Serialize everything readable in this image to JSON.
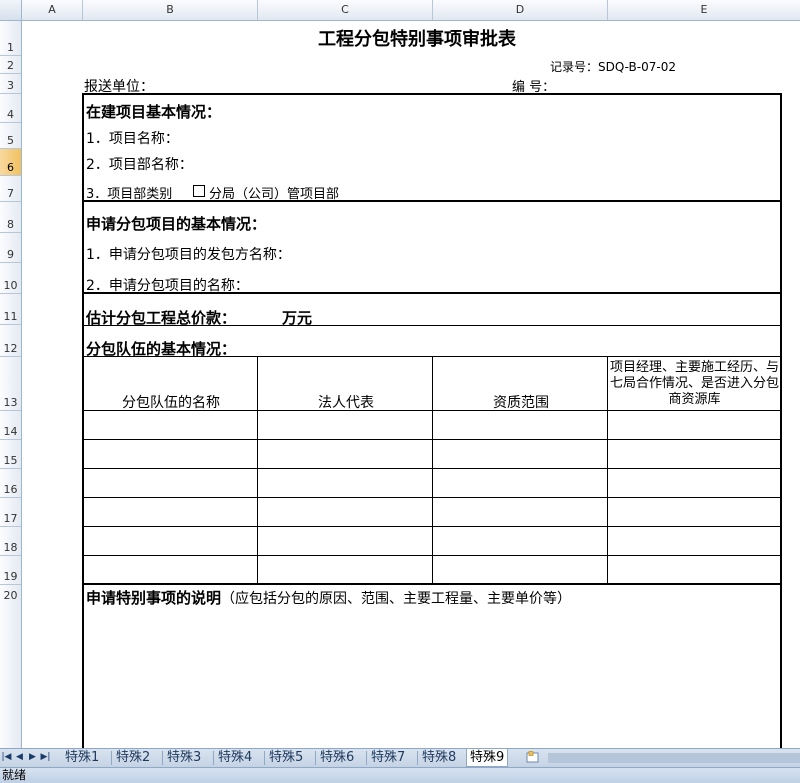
{
  "columns": [
    "A",
    "B",
    "C",
    "D",
    "E"
  ],
  "rows": [
    "1",
    "2",
    "3",
    "4",
    "5",
    "6",
    "7",
    "8",
    "9",
    "10",
    "11",
    "12",
    "13",
    "14",
    "15",
    "16",
    "17",
    "18",
    "19",
    "20"
  ],
  "selected_row": "6",
  "form": {
    "title": "工程分包特别事项审批表",
    "record_no": "记录号：SDQ-B-07-02",
    "submit_unit": "报送单位：",
    "number_label": "编    号：",
    "section1_title": "在建项目基本情况：",
    "project_name": "1．项目名称：",
    "dept_name": "2．项目部名称：",
    "dept_type": "3．项目部类别",
    "dept_type_option": "分局（公司）管项目部",
    "section2_title": "申请分包项目的基本情况：",
    "contractor_name": "1．申请分包项目的发包方名称：",
    "sub_project_name": "2．申请分包项目的名称：",
    "estimate_label": "估计分包工程总价款：",
    "estimate_unit": "万元",
    "team_title": "分包队伍的基本情况：",
    "table_headers": [
      "分包队伍的名称",
      "法人代表",
      "资质范围",
      "项目经理、主要施工经历、与七局合作情况、是否进入分包商资源库"
    ],
    "special_title": "申请特别事项的说明",
    "special_note": "（应包括分包的原因、范围、主要工程量、主要单价等）"
  },
  "sheet_tabs": [
    "特殊1",
    "特殊2",
    "特殊3",
    "特殊4",
    "特殊5",
    "特殊6",
    "特殊7",
    "特殊8",
    "特殊9"
  ],
  "active_tab": "特殊9",
  "status": "就绪"
}
